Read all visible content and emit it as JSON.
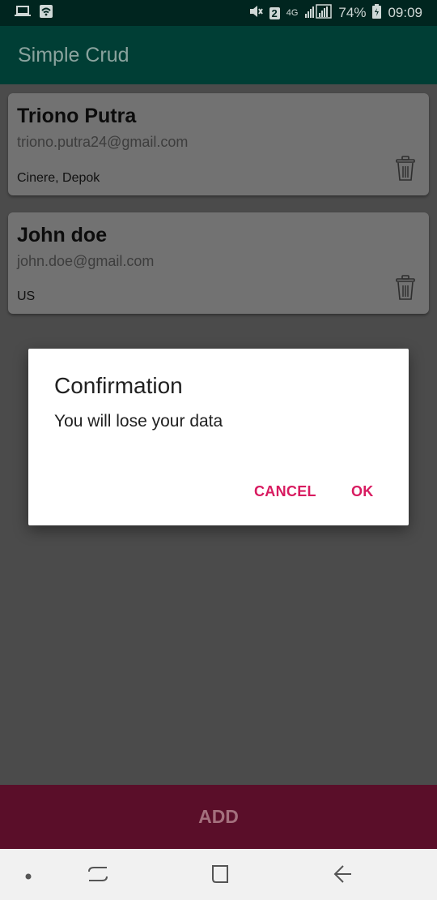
{
  "status_bar": {
    "sim_slot": "2",
    "network": "4G",
    "battery": "74%",
    "time": "09:09",
    "icons": [
      "laptop-icon",
      "wifi-icon",
      "mute-icon",
      "signal-icon",
      "battery-icon"
    ]
  },
  "app_bar": {
    "title": "Simple Crud"
  },
  "contacts": [
    {
      "name": "Triono Putra",
      "email": "triono.putra24@gmail.com",
      "address": "Cinere, Depok",
      "delete_icon": "trash-icon"
    },
    {
      "name": "John doe",
      "email": "john.doe@gmail.com",
      "address": "US",
      "delete_icon": "trash-icon"
    }
  ],
  "dialog": {
    "title": "Confirmation",
    "message": "You will lose your data",
    "cancel_label": "CANCEL",
    "ok_label": "OK"
  },
  "add_button": {
    "label": "ADD"
  },
  "nav_bar": {
    "icons": [
      "dot-icon",
      "recent-apps-icon",
      "home-icon",
      "back-icon"
    ]
  },
  "colors": {
    "status_bar": "#00251f",
    "app_bar": "#003e35",
    "accent": "#d81b60",
    "add_bar": "#5a0e29"
  }
}
